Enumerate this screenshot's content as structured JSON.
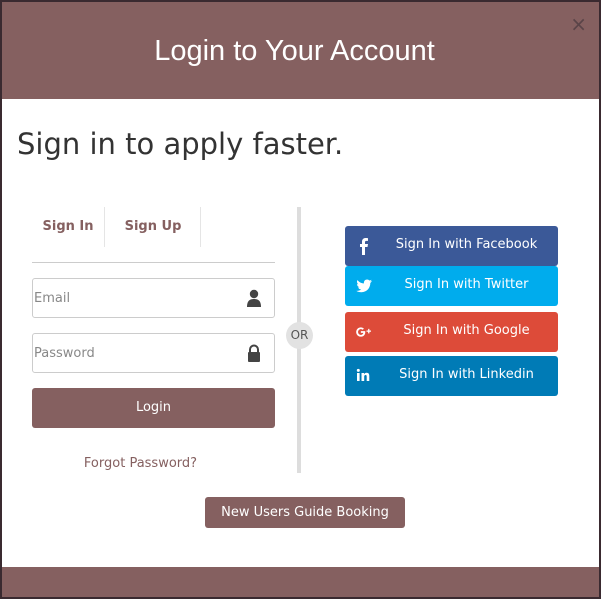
{
  "modal": {
    "title": "Login to Your Account",
    "close_label": "×",
    "subtitle": "Sign in to apply faster."
  },
  "tabs": [
    {
      "label": "Sign In"
    },
    {
      "label": "Sign Up"
    }
  ],
  "form": {
    "email_placeholder": "Email",
    "email_value": "",
    "password_placeholder": "Password",
    "password_value": "",
    "login_label": "Login",
    "forgot_label": "Forgot Password?"
  },
  "divider_label": "OR",
  "social": [
    {
      "label": "Sign In with Facebook",
      "icon": "facebook-icon",
      "color": "#3b5998"
    },
    {
      "label": "Sign In with Twitter",
      "icon": "twitter-icon",
      "color": "#00aced"
    },
    {
      "label": "Sign In with Google",
      "icon": "google-plus-icon",
      "color": "#dd4b39"
    },
    {
      "label": "Sign In with Linkedin",
      "icon": "linkedin-icon",
      "color": "#007bb6"
    }
  ],
  "guide_button_label": "New Users Guide Booking",
  "colors": {
    "accent": "#856060",
    "text": "#333333"
  }
}
